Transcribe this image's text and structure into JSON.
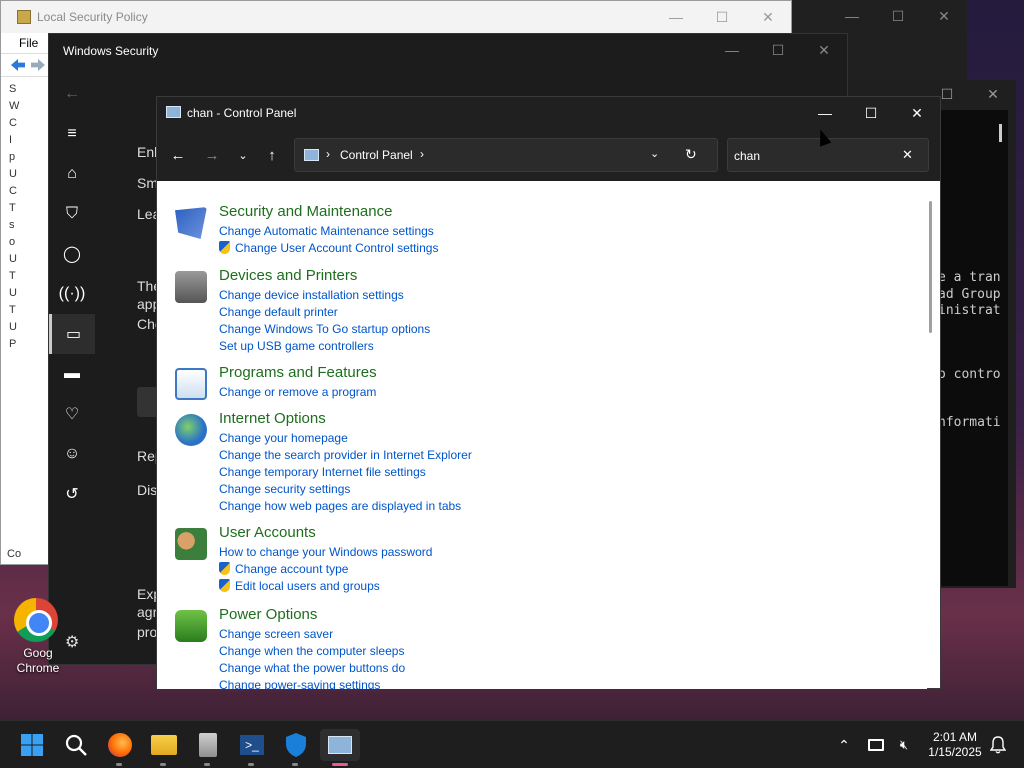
{
  "lsp_window": {
    "title": "Local Security Policy",
    "menu_file": "File",
    "tree": [
      "S",
      "W",
      "C",
      "I",
      "p",
      "U",
      "C",
      "T",
      "s",
      "o",
      "U",
      "T",
      "U",
      "T",
      "U",
      "P"
    ],
    "footer": "Co"
  },
  "terminal": {
    "lines": [
      "e a tran",
      "ad Group",
      "inistrat",
      "o contro",
      "nformati"
    ]
  },
  "windows_security": {
    "title": "Windows Security",
    "fragments": [
      "Enl",
      "Sm",
      "Lea",
      "The",
      "app",
      "Che",
      "Rep",
      "Dis",
      "Exp",
      "agr",
      "pro"
    ]
  },
  "desktop": {
    "chrome_label_line1": "Goog",
    "chrome_label_line2": "Chrome"
  },
  "control_panel": {
    "title": "chan - Control Panel",
    "breadcrumb": "Control Panel",
    "search_value": "chan",
    "groups": [
      {
        "title": "Security and Maintenance",
        "tasks": [
          {
            "label": "Change Automatic Maintenance settings",
            "shield": false
          },
          {
            "label": "Change User Account Control settings",
            "shield": true
          }
        ]
      },
      {
        "title": "Devices and Printers",
        "tasks": [
          {
            "label": "Change device installation settings",
            "shield": false
          },
          {
            "label": "Change default printer",
            "shield": false
          },
          {
            "label": "Change Windows To Go startup options",
            "shield": false
          },
          {
            "label": "Set up USB game controllers",
            "shield": false
          }
        ]
      },
      {
        "title": "Programs and Features",
        "tasks": [
          {
            "label": "Change or remove a program",
            "shield": false
          }
        ]
      },
      {
        "title": "Internet Options",
        "tasks": [
          {
            "label": "Change your homepage",
            "shield": false
          },
          {
            "label": "Change the search provider in Internet Explorer",
            "shield": false
          },
          {
            "label": "Change temporary Internet file settings",
            "shield": false
          },
          {
            "label": "Change security settings",
            "shield": false
          },
          {
            "label": "Change how web pages are displayed in tabs",
            "shield": false
          }
        ]
      },
      {
        "title": "User Accounts",
        "tasks": [
          {
            "label": "How to change your Windows password",
            "shield": false
          },
          {
            "label": "Change account type",
            "shield": true
          },
          {
            "label": "Edit local users and groups",
            "shield": true
          }
        ]
      },
      {
        "title": "Power Options",
        "tasks": [
          {
            "label": "Change screen saver",
            "shield": false
          },
          {
            "label": "Change when the computer sleeps",
            "shield": false
          },
          {
            "label": "Change what the power buttons do",
            "shield": false
          },
          {
            "label": "Change power-saving settings",
            "shield": false
          }
        ]
      }
    ]
  },
  "taskbar": {
    "time": "2:01 AM",
    "date": "1/15/2025"
  },
  "colors": {
    "group_title": "#1e6e1e",
    "task_link": "#0055cc",
    "title_bar": "#202020",
    "active_indicator": "#e85a94"
  }
}
